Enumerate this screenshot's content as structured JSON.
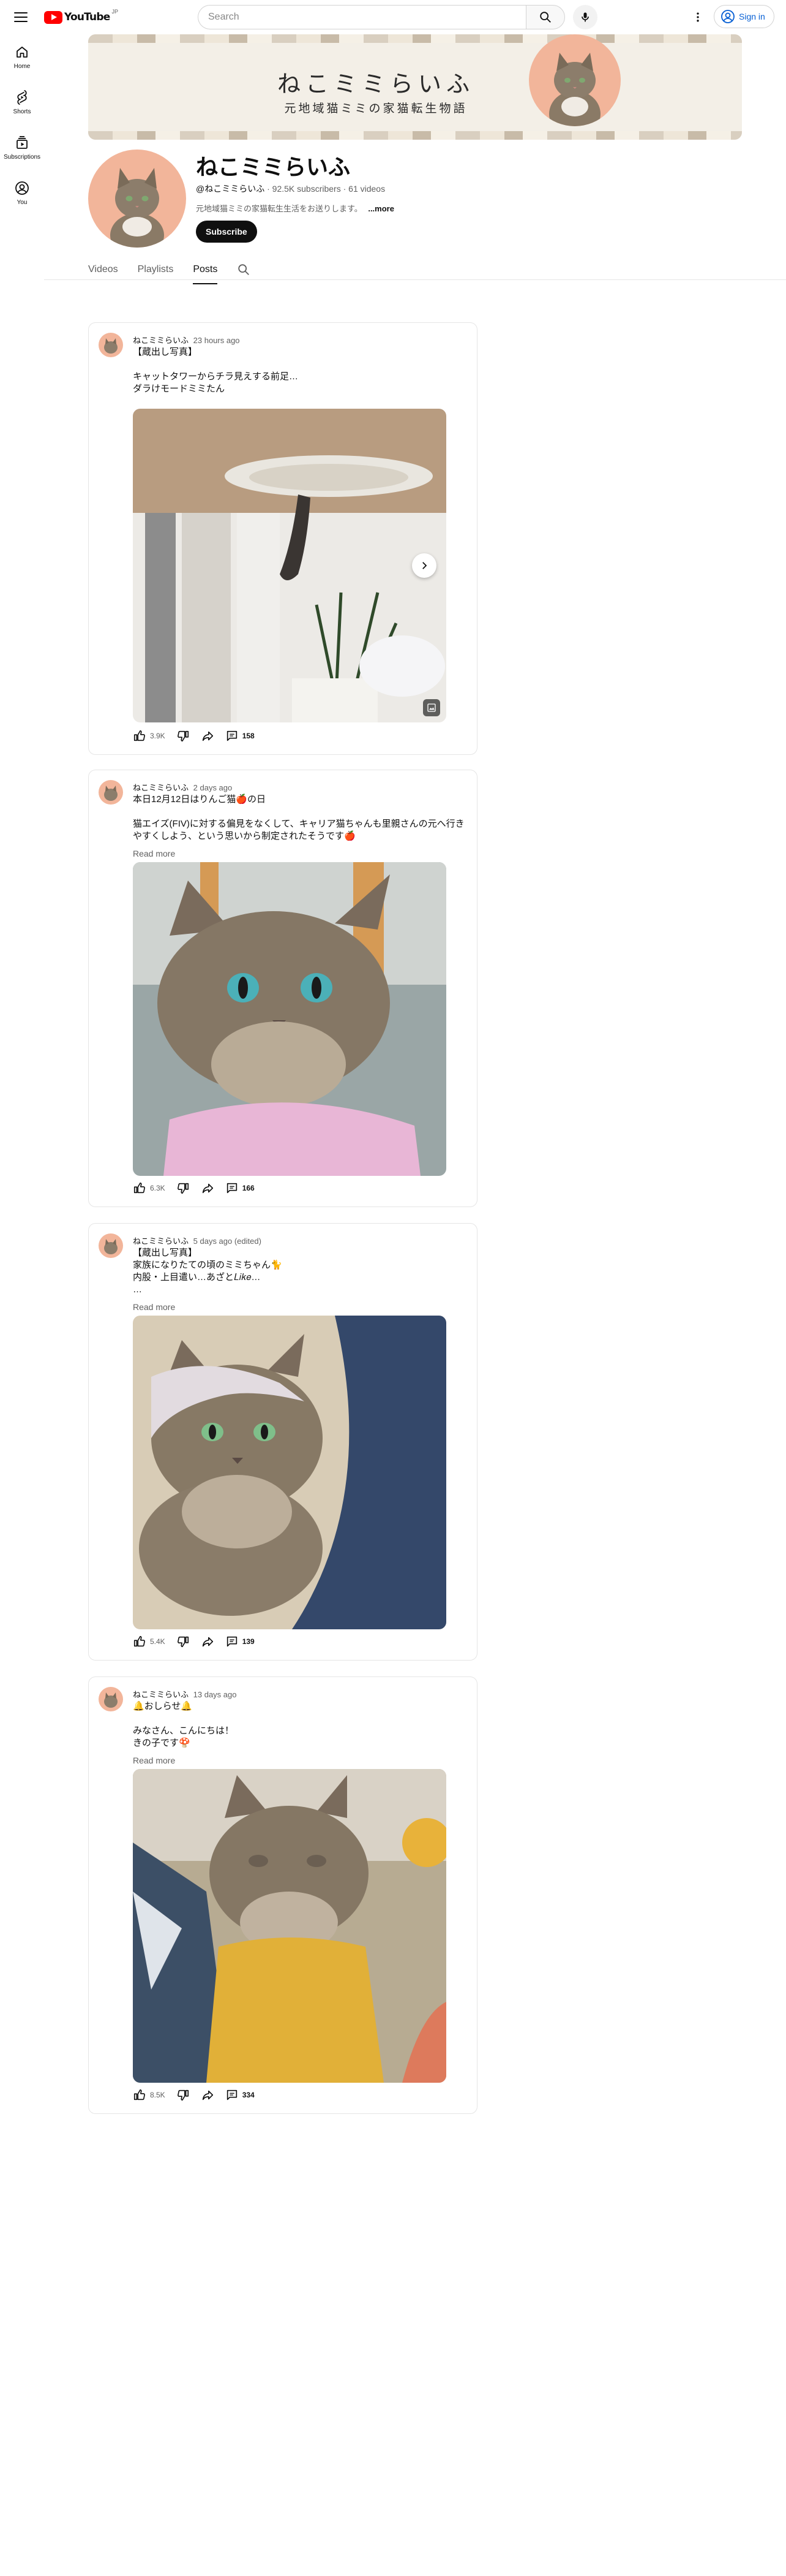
{
  "topbar": {
    "logo_text": "YouTube",
    "logo_country": "JP",
    "search_placeholder": "Search",
    "signin_label": "Sign in"
  },
  "rail": [
    {
      "label": "Home",
      "icon": "home-icon"
    },
    {
      "label": "Shorts",
      "icon": "shorts-icon"
    },
    {
      "label": "Subscriptions",
      "icon": "subscriptions-icon"
    },
    {
      "label": "You",
      "icon": "you-icon"
    }
  ],
  "banner": {
    "title": "ねこミミらいふ",
    "subtitle": "元地域猫ミミの家猫転生物語"
  },
  "channel": {
    "name": "ねこミミらいふ",
    "handle": "@ねこミミらいふ",
    "stats": "· 92.5K subscribers · 61 videos",
    "description": "元地域猫ミミの家猫転生生活をお送りします。",
    "more_label": "...more",
    "subscribe_label": "Subscribe"
  },
  "tabs": [
    {
      "label": "Videos",
      "active": false
    },
    {
      "label": "Playlists",
      "active": false
    },
    {
      "label": "Posts",
      "active": true
    }
  ],
  "posts": [
    {
      "author": "ねこミミらいふ",
      "time": "23 hours ago",
      "text": "【蔵出し写真】\n\nキャットタワーからチラ見えする前足…\nダラけモードミミたん",
      "read_more": "",
      "likes": "3.9K",
      "comments": "158"
    },
    {
      "author": "ねこミミらいふ",
      "time": "2 days ago",
      "text": "本日12月12日はりんご猫🍎の日\n\n猫エイズ(FIV)に対する偏見をなくして、キャリア猫ちゃんも里親さんの元へ行きやすくしよう、という思いから制定されたそうです🍎",
      "read_more": "Read more",
      "likes": "6.3K",
      "comments": "166"
    },
    {
      "author": "ねこミミらいふ",
      "time": "5 days ago (edited)",
      "text": "【蔵出し写真】\n家族になりたての頃のミミちゃん🐈\n内股・上目遣い…あざと𝐿𝑖𝑘𝑒…\n…",
      "read_more": "Read more",
      "likes": "5.4K",
      "comments": "139"
    },
    {
      "author": "ねこミミらいふ",
      "time": "13 days ago",
      "text": "🔔おしらせ🔔\n\nみなさん、こんにちは！\nきの子です🍄",
      "read_more": "Read more",
      "likes": "8.5K",
      "comments": "334"
    }
  ],
  "colors": {
    "accent_red": "#ff0000",
    "link_blue": "#065fd4",
    "avatar_peach": "#f2b59a"
  }
}
